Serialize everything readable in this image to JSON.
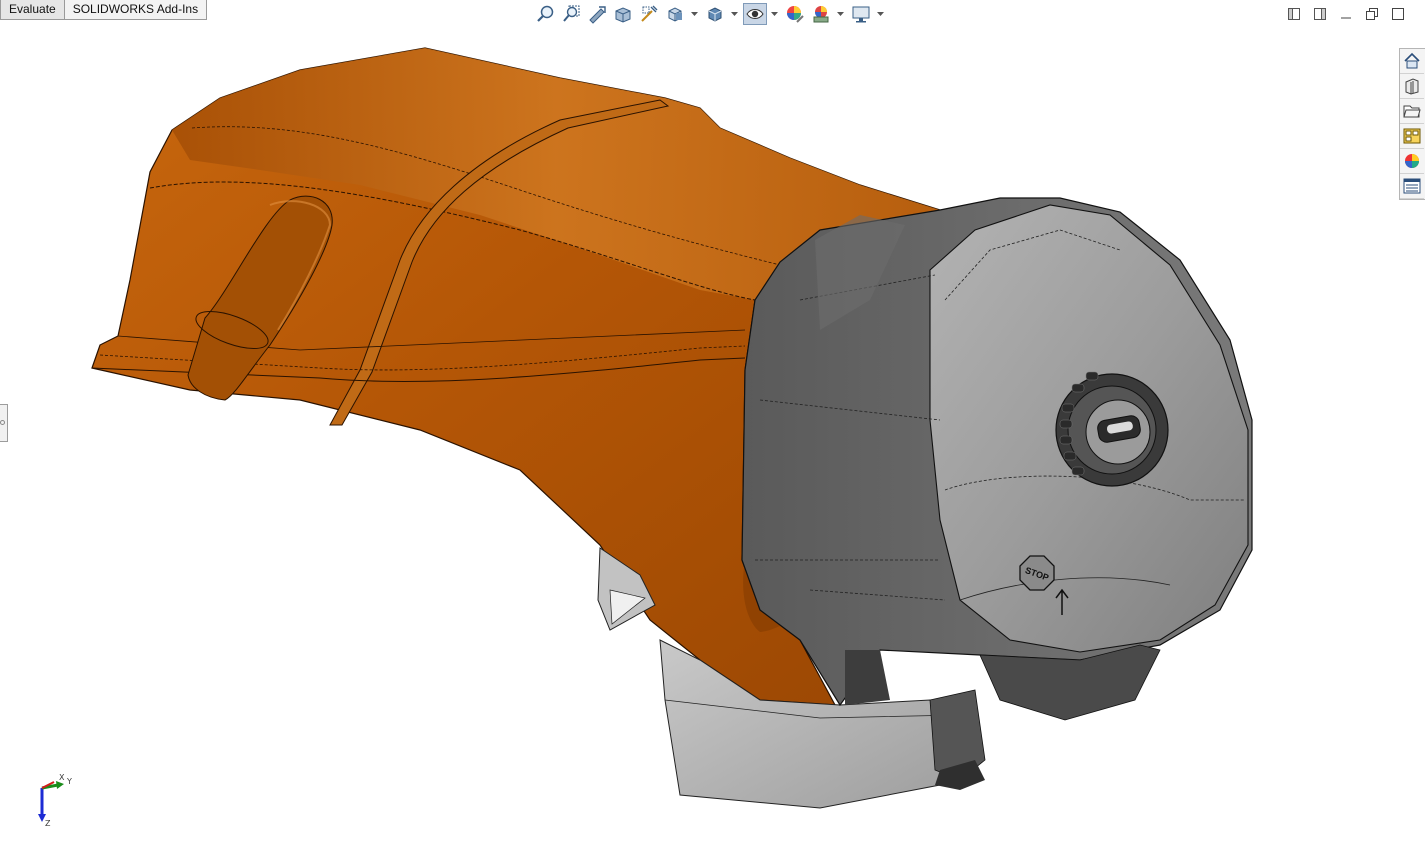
{
  "tabs": [
    {
      "label": "Evaluate"
    },
    {
      "label": "SOLIDWORKS Add-Ins"
    }
  ],
  "toolbar": {
    "items": [
      {
        "icon": "zoom-to-fit-icon"
      },
      {
        "icon": "zoom-to-area-icon"
      },
      {
        "icon": "previous-view-icon"
      },
      {
        "icon": "section-view-icon"
      },
      {
        "icon": "dynamic-annotation-views-icon"
      },
      {
        "icon": "view-orientation-icon",
        "dropdown": true
      },
      {
        "icon": "display-style-icon",
        "dropdown": true
      },
      {
        "icon": "hide-show-items-icon",
        "dropdown": true,
        "pressed": true
      },
      {
        "icon": "edit-appearance-icon"
      },
      {
        "icon": "apply-scene-icon",
        "dropdown": true
      },
      {
        "icon": "view-settings-icon",
        "dropdown": true
      }
    ]
  },
  "taskpane": [
    {
      "icon": "solidworks-resources-icon"
    },
    {
      "icon": "design-library-icon"
    },
    {
      "icon": "file-explorer-icon"
    },
    {
      "icon": "view-palette-icon"
    },
    {
      "icon": "appearances-scenes-icon"
    },
    {
      "icon": "custom-properties-icon"
    }
  ],
  "triad": {
    "x_label": "X",
    "y_label": "Y",
    "z_label": "Z"
  },
  "colors": {
    "housing_orange": "#b85a0a",
    "housing_orange_light": "#d9822c",
    "cap_gray": "#8d8d8d",
    "cap_gray_dark": "#505050",
    "background": "#ffffff"
  },
  "model": {
    "stop_label": "STOP"
  }
}
